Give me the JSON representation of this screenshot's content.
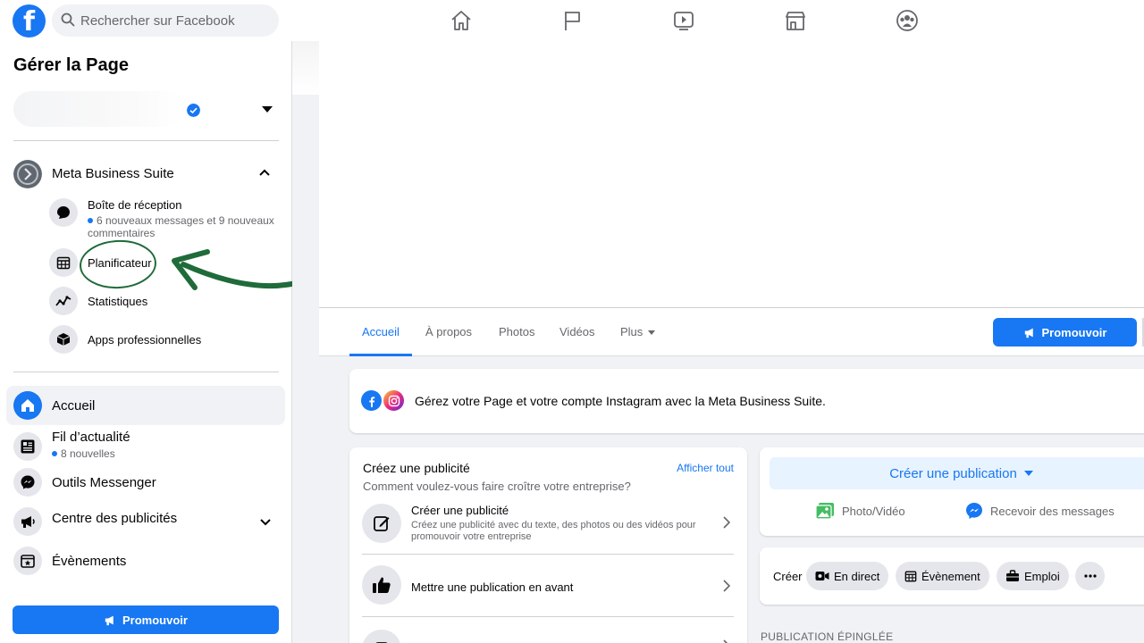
{
  "search": {
    "placeholder": "Rechercher sur Facebook"
  },
  "nav": {
    "icons": [
      "home-icon",
      "flag-icon",
      "video-icon",
      "marketplace-icon",
      "groups-icon"
    ]
  },
  "sidebar": {
    "title": "Gérer la Page",
    "meta_business_suite": {
      "label": "Meta Business Suite",
      "items": [
        {
          "label": "Boîte de réception",
          "meta": "6 nouveaux messages et 9 nouveaux commentaires",
          "icon": "chat-bubble-icon"
        },
        {
          "label": "Planificateur",
          "icon": "calendar-icon"
        },
        {
          "label": "Statistiques",
          "icon": "insights-icon"
        },
        {
          "label": "Apps professionnelles",
          "icon": "box-icon"
        }
      ]
    },
    "main_items": [
      {
        "label": "Accueil",
        "icon": "home-icon",
        "active": true
      },
      {
        "label": "Fil d’actualité",
        "meta": "8 nouvelles",
        "icon": "newsfeed-icon"
      },
      {
        "label": "Outils Messenger",
        "icon": "messenger-icon"
      },
      {
        "label": "Centre des publicités",
        "icon": "megaphone-icon"
      },
      {
        "label": "Évènements",
        "icon": "calendar-star-icon"
      }
    ],
    "promote_label": "Promouvoir"
  },
  "tabs": [
    {
      "label": "Accueil",
      "active": true
    },
    {
      "label": "À propos"
    },
    {
      "label": "Photos"
    },
    {
      "label": "Vidéos"
    },
    {
      "label": "Plus"
    }
  ],
  "header": {
    "promote_label": "Promouvoir"
  },
  "banner": {
    "text": "Gérez votre Page et votre compte Instagram avec la Meta Business Suite."
  },
  "ad_card": {
    "title": "Créez une publicité",
    "link": "Afficher tout",
    "subtitle": "Comment voulez-vous faire croître votre entreprise?",
    "rows": [
      {
        "title": "Créer une publicité",
        "desc": "Créez une publicité avec du texte, des photos ou des vidéos pour promouvoir votre entreprise"
      },
      {
        "title": "Mettre une publication en avant"
      }
    ]
  },
  "publication": {
    "create_label": "Créer une publication",
    "photo_label": "Photo/Vidéo",
    "messages_label": "Recevoir des messages"
  },
  "create_bar": {
    "label": "Créer",
    "chips": [
      "En direct",
      "Évènement",
      "Emploi"
    ]
  },
  "pinned_label": "PUBLICATION ÉPINGLÉE",
  "colors": {
    "accent": "#1877f2",
    "annotation_green": "#1f6b3a"
  }
}
